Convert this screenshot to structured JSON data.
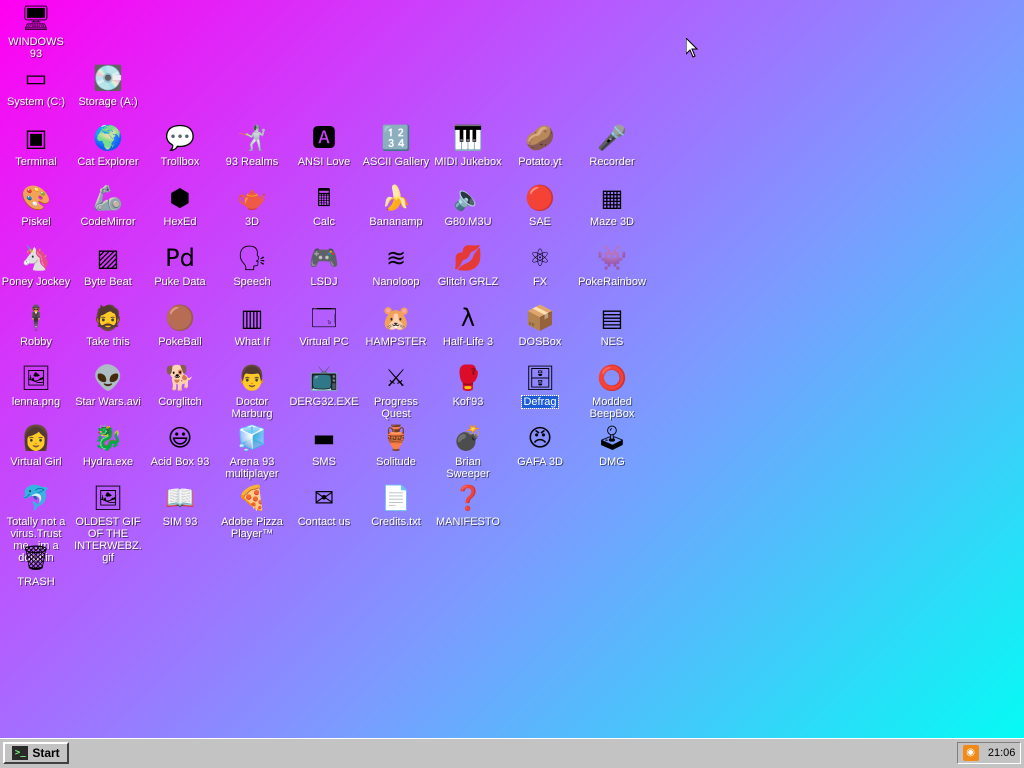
{
  "desktop": {
    "icons": [
      {
        "label": "WINDOWS 93",
        "icon": "computer-icon",
        "glyph": "🖥",
        "col": 0,
        "row": 0
      },
      {
        "label": "System (C:)",
        "icon": "drive-icon",
        "glyph": "▭",
        "col": 0,
        "row": 1
      },
      {
        "label": "Storage (A:)",
        "icon": "floppy-drive-icon",
        "glyph": "💽",
        "col": 1,
        "row": 1
      },
      {
        "label": "Terminal",
        "icon": "terminal-icon",
        "glyph": "▣",
        "col": 0,
        "row": 2
      },
      {
        "label": "Cat Explorer",
        "icon": "cat-globe-icon",
        "glyph": "🌍",
        "col": 1,
        "row": 2
      },
      {
        "label": "Trollbox",
        "icon": "chat-bubble-icon",
        "glyph": "💬",
        "col": 2,
        "row": 2
      },
      {
        "label": "93 Realms",
        "icon": "knight-icon",
        "glyph": "🤺",
        "col": 3,
        "row": 2
      },
      {
        "label": "ANSI Love",
        "icon": "ansi-pen-icon",
        "glyph": "🅰",
        "col": 4,
        "row": 2
      },
      {
        "label": "ASCII Gallery",
        "icon": "ascii-numbers-icon",
        "glyph": "🔢",
        "col": 5,
        "row": 2
      },
      {
        "label": "MIDI Jukebox",
        "icon": "piano-icon",
        "glyph": "🎹",
        "col": 6,
        "row": 2
      },
      {
        "label": "Potato.yt",
        "icon": "potato-icon",
        "glyph": "🥔",
        "col": 7,
        "row": 2
      },
      {
        "label": "Recorder",
        "icon": "microphone-icon",
        "glyph": "🎤",
        "col": 8,
        "row": 2
      },
      {
        "label": "Piskel",
        "icon": "palette-icon",
        "glyph": "🎨",
        "col": 0,
        "row": 3
      },
      {
        "label": "CodeMirror",
        "icon": "codemirror-icon",
        "glyph": "🦾",
        "col": 1,
        "row": 3
      },
      {
        "label": "HexEd",
        "icon": "cube-icon",
        "glyph": "⬢",
        "col": 2,
        "row": 3
      },
      {
        "label": "3D",
        "icon": "teapot-icon",
        "glyph": "🫖",
        "col": 3,
        "row": 3
      },
      {
        "label": "Calc",
        "icon": "calculator-icon",
        "glyph": "🖩",
        "col": 4,
        "row": 3
      },
      {
        "label": "Bananamp",
        "icon": "banana-icon",
        "glyph": "🍌",
        "col": 5,
        "row": 3
      },
      {
        "label": "G80.M3U",
        "icon": "audio-file-icon",
        "glyph": "🔈",
        "col": 6,
        "row": 3
      },
      {
        "label": "SAE",
        "icon": "checkered-ball-icon",
        "glyph": "🔴",
        "col": 7,
        "row": 3
      },
      {
        "label": "Maze 3D",
        "icon": "maze-icon",
        "glyph": "▦",
        "col": 8,
        "row": 3
      },
      {
        "label": "Poney Jockey",
        "icon": "pony-icon",
        "glyph": "🦄",
        "col": 0,
        "row": 4
      },
      {
        "label": "Byte Beat",
        "icon": "bytebeat-icon",
        "glyph": "▨",
        "col": 1,
        "row": 4
      },
      {
        "label": "Puke Data",
        "icon": "puredata-icon",
        "glyph": "Pd",
        "col": 2,
        "row": 4
      },
      {
        "label": "Speech",
        "icon": "face-speech-icon",
        "glyph": "🗣",
        "col": 3,
        "row": 4
      },
      {
        "label": "LSDJ",
        "icon": "lsdj-icon",
        "glyph": "🎮",
        "col": 4,
        "row": 4
      },
      {
        "label": "Nanoloop",
        "icon": "waveform-icon",
        "glyph": "≋",
        "col": 5,
        "row": 4
      },
      {
        "label": "Glitch GRLZ",
        "icon": "lips-icon",
        "glyph": "💋",
        "col": 6,
        "row": 4
      },
      {
        "label": "FX",
        "icon": "atom-icon",
        "glyph": "⚛",
        "col": 7,
        "row": 4
      },
      {
        "label": "PokeRainbow",
        "icon": "pokerainbow-icon",
        "glyph": "👾",
        "col": 8,
        "row": 4
      },
      {
        "label": "Robby",
        "icon": "stick-figure-icon",
        "glyph": "🕴",
        "col": 0,
        "row": 5
      },
      {
        "label": "Take this",
        "icon": "pixel-man-icon",
        "glyph": "🧔",
        "col": 1,
        "row": 5
      },
      {
        "label": "PokeBall",
        "icon": "pokeball-icon",
        "glyph": "🟤",
        "col": 2,
        "row": 5
      },
      {
        "label": "What If",
        "icon": "barcode-icon",
        "glyph": "▥",
        "col": 3,
        "row": 5
      },
      {
        "label": "Virtual PC",
        "icon": "window-icon",
        "glyph": "🗔",
        "col": 4,
        "row": 5
      },
      {
        "label": "HAMPSTER",
        "icon": "hamster-icon",
        "glyph": "🐹",
        "col": 5,
        "row": 5
      },
      {
        "label": "Half-Life 3",
        "icon": "lambda-icon",
        "glyph": "λ",
        "col": 6,
        "row": 5
      },
      {
        "label": "DOSBox",
        "icon": "dosbox-icon",
        "glyph": "📦",
        "col": 7,
        "row": 5
      },
      {
        "label": "NES",
        "icon": "nes-console-icon",
        "glyph": "▤",
        "col": 8,
        "row": 5
      },
      {
        "label": "lenna.png",
        "icon": "image-file-icon",
        "glyph": "🖼",
        "col": 0,
        "row": 6
      },
      {
        "label": "Star Wars.avi",
        "icon": "yoda-icon",
        "glyph": "👽",
        "col": 1,
        "row": 6
      },
      {
        "label": "Corglitch",
        "icon": "corgi-icon",
        "glyph": "🐕",
        "col": 2,
        "row": 6
      },
      {
        "label": "Doctor Marburg",
        "icon": "doctor-icon",
        "glyph": "👨",
        "col": 3,
        "row": 6
      },
      {
        "label": "DERG32.EXE",
        "icon": "monitor-face-icon",
        "glyph": "📺",
        "col": 4,
        "row": 6
      },
      {
        "label": "Progress Quest",
        "icon": "crossed-swords-icon",
        "glyph": "⚔",
        "col": 5,
        "row": 6
      },
      {
        "label": "Kof'93",
        "icon": "fighter-icon",
        "glyph": "🥊",
        "col": 6,
        "row": 6
      },
      {
        "label": "Defrag",
        "icon": "defrag-icon",
        "glyph": "🗄",
        "col": 7,
        "row": 6,
        "selected": true
      },
      {
        "label": "Modded BeepBox",
        "icon": "ring-icon",
        "glyph": "⭕",
        "col": 8,
        "row": 6
      },
      {
        "label": "Virtual Girl",
        "icon": "girl-face-icon",
        "glyph": "👩",
        "col": 0,
        "row": 7
      },
      {
        "label": "Hydra.exe",
        "icon": "hydra-icon",
        "glyph": "🐉",
        "col": 1,
        "row": 7
      },
      {
        "label": "Acid Box 93",
        "icon": "smiley-icon",
        "glyph": "😃",
        "col": 2,
        "row": 7
      },
      {
        "label": "Arena 93 multiplayer",
        "icon": "colored-cube-icon",
        "glyph": "🧊",
        "col": 3,
        "row": 7
      },
      {
        "label": "SMS",
        "icon": "sms-console-icon",
        "glyph": "▬",
        "col": 4,
        "row": 7
      },
      {
        "label": "Solitude",
        "icon": "jar-icon",
        "glyph": "🏺",
        "col": 5,
        "row": 7
      },
      {
        "label": "Brian Sweeper",
        "icon": "mine-icon",
        "glyph": "💣",
        "col": 6,
        "row": 7
      },
      {
        "label": "GAFA 3D",
        "icon": "doom-face-icon",
        "glyph": "😠",
        "col": 7,
        "row": 7
      },
      {
        "label": "DMG",
        "icon": "gameboy-icon",
        "glyph": "🕹",
        "col": 8,
        "row": 7
      },
      {
        "label": "Totally not a virus.Trust me...im a dolphin",
        "icon": "dolphin-icon",
        "glyph": "🐬",
        "col": 0,
        "row": 8
      },
      {
        "label": "OLDEST GIF OF THE INTERWEBZ.gif",
        "icon": "gif-file-icon",
        "glyph": "🖼",
        "col": 1,
        "row": 8
      },
      {
        "label": "SIM 93",
        "icon": "book-icon",
        "glyph": "📖",
        "col": 2,
        "row": 8
      },
      {
        "label": "Adobe Pizza Player™",
        "icon": "pizza-icon",
        "glyph": "🍕",
        "col": 3,
        "row": 8
      },
      {
        "label": "Contact us",
        "icon": "letter-pen-icon",
        "glyph": "✉",
        "col": 4,
        "row": 8
      },
      {
        "label": "Credits.txt",
        "icon": "text-file-icon",
        "glyph": "📄",
        "col": 5,
        "row": 8
      },
      {
        "label": "MANIFESTO",
        "icon": "question-mark-icon",
        "glyph": "❓",
        "col": 6,
        "row": 8
      },
      {
        "label": "TRASH",
        "icon": "recycle-bin-icon",
        "glyph": "🗑",
        "col": 0,
        "row": 9
      }
    ]
  },
  "taskbar": {
    "start_label": "Start",
    "start_glyph": ">_",
    "tray_icon": "rss-icon",
    "clock": "21:06"
  }
}
